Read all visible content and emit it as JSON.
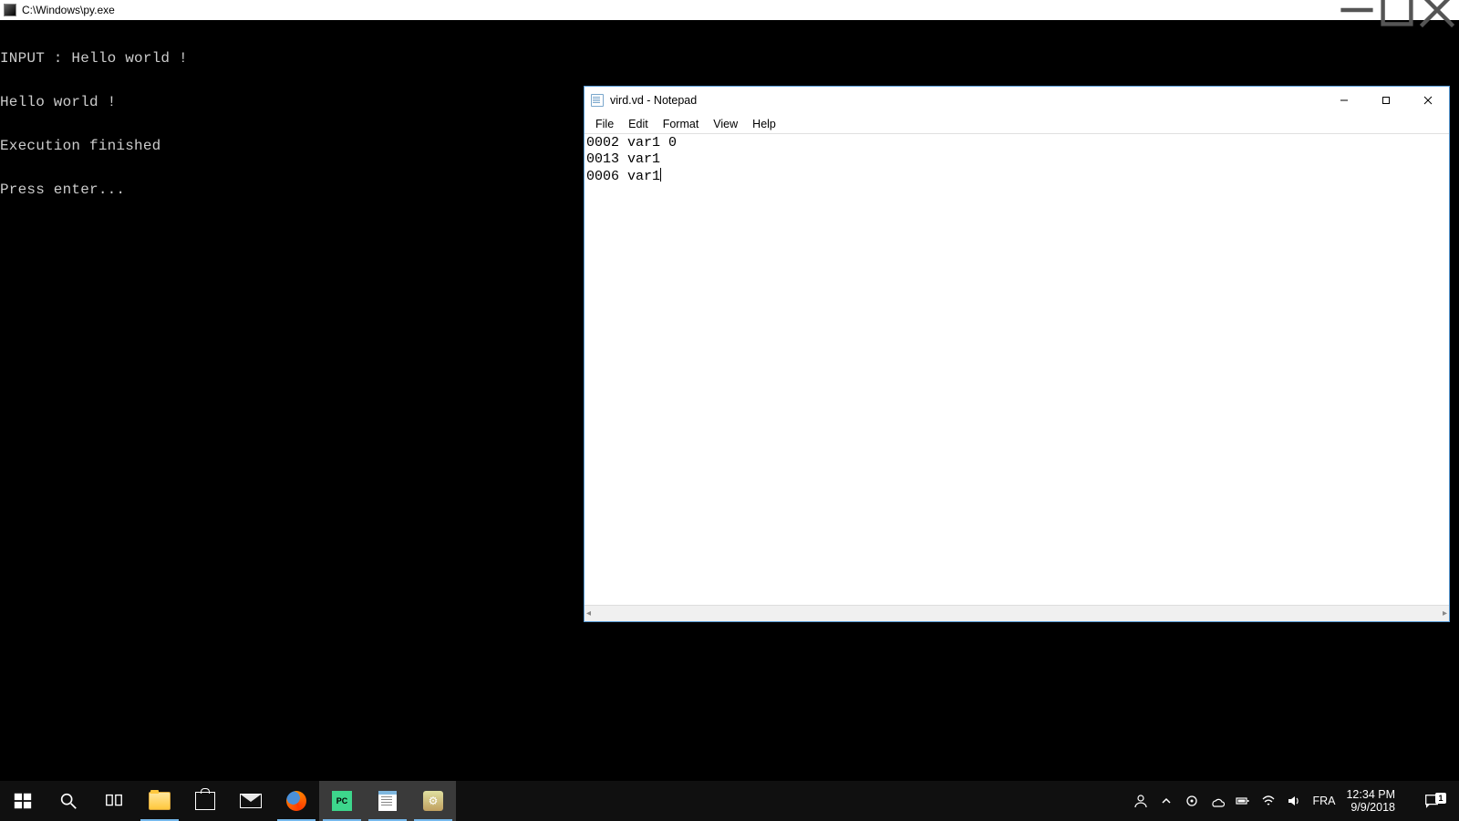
{
  "console": {
    "title": "C:\\Windows\\py.exe",
    "lines": [
      "INPUT : Hello world !",
      "Hello world !",
      "Execution finished",
      "Press enter..."
    ]
  },
  "notepad": {
    "title": "vird.vd - Notepad",
    "menus": {
      "file": "File",
      "edit": "Edit",
      "format": "Format",
      "view": "View",
      "help": "Help"
    },
    "content": "0002 var1 0\n0013 var1\n0006 var1"
  },
  "taskbar": {
    "items": [
      {
        "name": "start-button"
      },
      {
        "name": "search-button"
      },
      {
        "name": "task-view-button"
      },
      {
        "name": "file-explorer",
        "active": true
      },
      {
        "name": "microsoft-store"
      },
      {
        "name": "mail"
      },
      {
        "name": "firefox",
        "active": true
      },
      {
        "name": "pycharm",
        "running": true,
        "active": true
      },
      {
        "name": "notepad",
        "running": true,
        "active": true
      },
      {
        "name": "other-app",
        "running": true,
        "active": true
      }
    ],
    "tray": {
      "language": "FRA",
      "time": "12:34 PM",
      "date": "9/9/2018",
      "notification_count": "1"
    }
  }
}
